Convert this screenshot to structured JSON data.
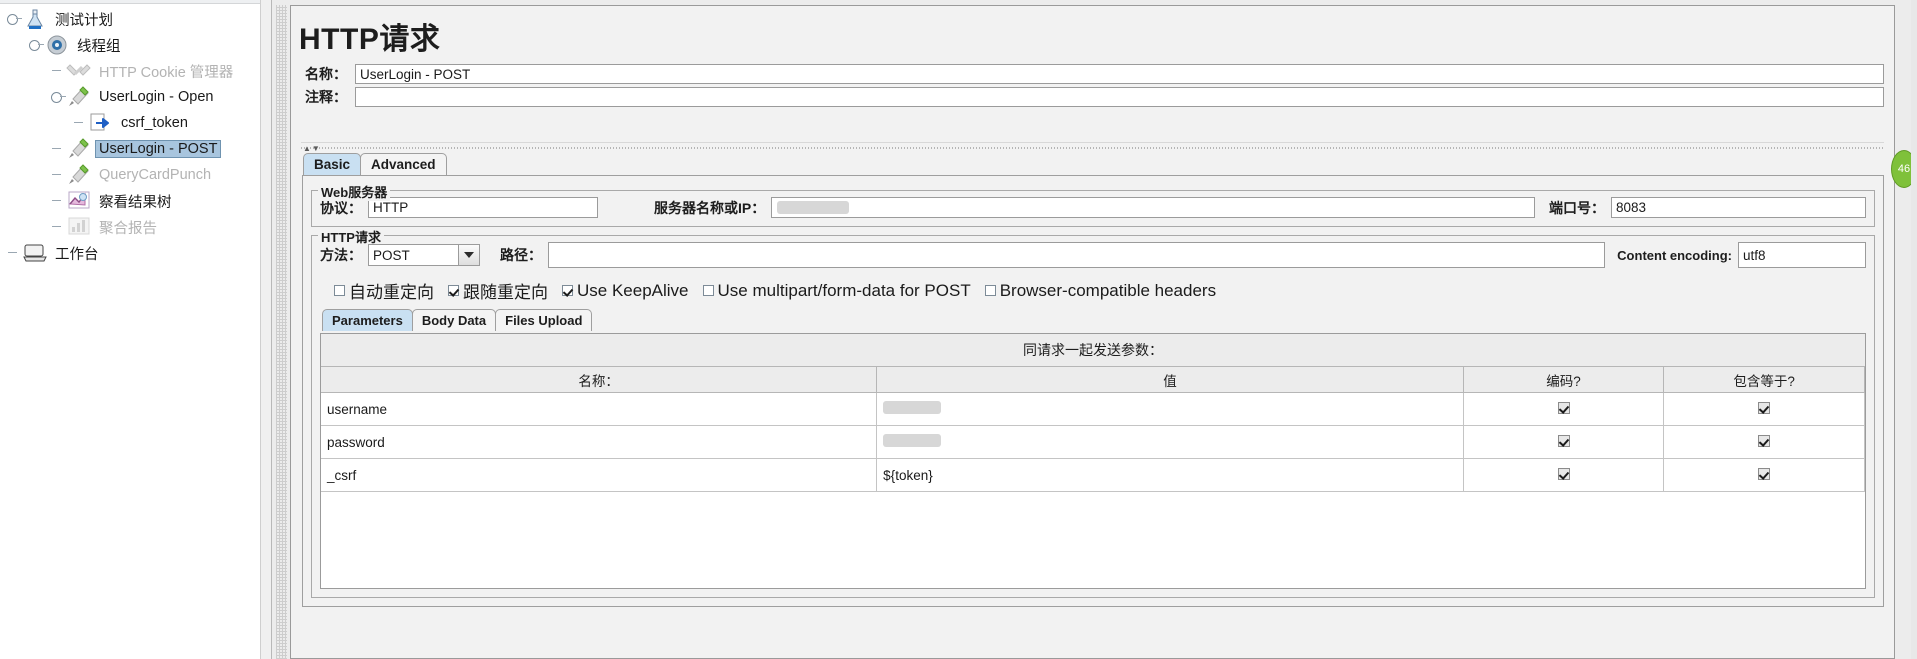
{
  "tree": {
    "nodes": [
      {
        "label": "测试计划",
        "icon": "test-plan-icon",
        "depth": 0,
        "state": "normal",
        "expander": true
      },
      {
        "label": "线程组",
        "icon": "thread-group-icon",
        "depth": 1,
        "state": "normal",
        "expander": true
      },
      {
        "label": "HTTP Cookie 管理器",
        "icon": "cookie-manager-icon",
        "depth": 2,
        "state": "disabled",
        "expander": false
      },
      {
        "label": "UserLogin - Open",
        "icon": "http-sampler-icon",
        "depth": 2,
        "state": "normal",
        "expander": true
      },
      {
        "label": "csrf_token",
        "icon": "post-processor-icon",
        "depth": 3,
        "state": "normal",
        "expander": false
      },
      {
        "label": "UserLogin - POST",
        "icon": "http-sampler-icon",
        "depth": 2,
        "state": "selected",
        "expander": false
      },
      {
        "label": "QueryCardPunch",
        "icon": "http-sampler-icon",
        "depth": 2,
        "state": "disabled",
        "expander": false
      },
      {
        "label": "察看结果树",
        "icon": "view-results-tree-icon",
        "depth": 2,
        "state": "normal",
        "expander": false
      },
      {
        "label": "聚合报告",
        "icon": "aggregate-report-icon",
        "depth": 2,
        "state": "disabled",
        "expander": false
      },
      {
        "label": "工作台",
        "icon": "workbench-icon",
        "depth": 0,
        "state": "normal",
        "expander": false
      }
    ]
  },
  "panel": {
    "title": "HTTP请求",
    "name_label": "名称：",
    "name_value": "UserLogin - POST",
    "comment_label": "注释：",
    "comment_value": ""
  },
  "main_tabs": [
    {
      "label": "Basic",
      "active": true
    },
    {
      "label": "Advanced",
      "active": false
    }
  ],
  "web_server": {
    "group_title": "Web服务器",
    "protocol_label": "协议：",
    "protocol_value": "HTTP",
    "server_label": "服务器名称或IP：",
    "server_value": "",
    "server_redacted": true,
    "port_label": "端口号：",
    "port_value": "8083"
  },
  "http_request": {
    "group_title": "HTTP请求",
    "method_label": "方法：",
    "method_value": "POST",
    "path_label": "路径：",
    "path_value": "",
    "encoding_label": "Content encoding:",
    "encoding_value": "utf8"
  },
  "options": [
    {
      "label": "自动重定向",
      "checked": false
    },
    {
      "label": "跟随重定向",
      "checked": true
    },
    {
      "label": "Use KeepAlive",
      "checked": true
    },
    {
      "label": "Use multipart/form-data for POST",
      "checked": false
    },
    {
      "label": "Browser-compatible headers",
      "checked": false
    }
  ],
  "param_tabs": [
    {
      "label": "Parameters",
      "active": true
    },
    {
      "label": "Body Data",
      "active": false
    },
    {
      "label": "Files Upload",
      "active": false
    }
  ],
  "params_table": {
    "caption": "同请求一起发送参数：",
    "headers": [
      "名称：",
      "值",
      "编码?",
      "包含等于?"
    ],
    "rows": [
      {
        "name": "username",
        "value": "",
        "value_redacted": true,
        "encode": true,
        "include_equals": true
      },
      {
        "name": "password",
        "value": "",
        "value_redacted": true,
        "encode": true,
        "include_equals": true
      },
      {
        "name": "_csrf",
        "value": "${token}",
        "value_redacted": false,
        "encode": true,
        "include_equals": true
      }
    ]
  },
  "side_badge": {
    "label": "46"
  },
  "colors": {
    "selection": "#a8c5de",
    "active_tab": "#c9e0f2",
    "panel_bg": "#f2f2f2",
    "badge": "#7fc13a"
  }
}
